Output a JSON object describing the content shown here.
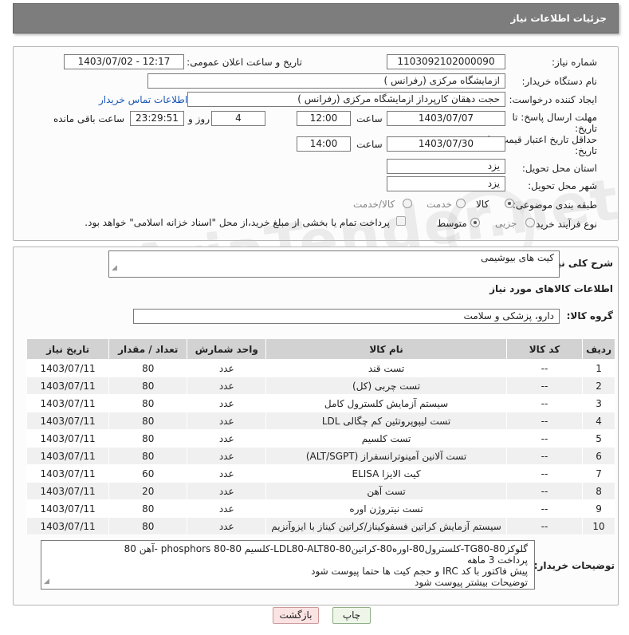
{
  "header": {
    "title": "جزئیات اطلاعات نیاز"
  },
  "form": {
    "need_number": {
      "label": "شماره نیاز:",
      "value": "1103092102000090"
    },
    "announce_datetime": {
      "label": "تاریخ و ساعت اعلان عمومی:",
      "value": "1403/07/02 - 12:17"
    },
    "buyer_org": {
      "label": "نام دستگاه خریدار:",
      "value": "ازمایشگاه مرکزی (رفرانس )"
    },
    "creator": {
      "label": "ایجاد کننده درخواست:",
      "value": "حجت دهقان کارپرداز ازمایشگاه مرکزی (رفرانس )",
      "contact_link": "اطلاعات تماس خریدار"
    },
    "reply_deadline": {
      "label_line1": "مهلت ارسال پاسخ: تا",
      "label_line2": "تاریخ:",
      "date": "1403/07/07",
      "time_label": "ساعت",
      "time": "12:00",
      "days": "4",
      "days_label": "روز و",
      "remaining": "23:29:51",
      "remaining_label": "ساعت باقی مانده"
    },
    "price_validity": {
      "label_line1": "حداقل تاریخ اعتبار قیمت: تا",
      "label_line2": "تاریخ:",
      "date": "1403/07/30",
      "time_label": "ساعت",
      "time": "14:00"
    },
    "delivery_province": {
      "label": "استان محل تحویل:",
      "value": "یزد"
    },
    "delivery_city": {
      "label": "شهر محل تحویل:",
      "value": "یزد"
    },
    "category": {
      "label": "طبقه بندی موضوعی:",
      "options": [
        "کالا",
        "خدمت",
        "کالا/خدمت"
      ],
      "selected": "کالا"
    },
    "purchase_type": {
      "label": "نوع فرآیند خرید :",
      "options": [
        "جزیی",
        "متوسط"
      ],
      "selected": "متوسط",
      "payment_note": "پرداخت تمام یا بخشی از مبلغ خرید،از محل \"اسناد خزانه اسلامی\" خواهد بود."
    }
  },
  "watermark": {
    "text": "AriaTender.net"
  },
  "summary": {
    "label": "شرح کلی نیاز:",
    "value": "کیت های بیوشیمی"
  },
  "goods_section": {
    "title": "اطلاعات کالاهای مورد نیاز"
  },
  "goods_group": {
    "label": "گروه کالا:",
    "value": "دارو، پزشکی و سلامت"
  },
  "table": {
    "headers": [
      "ردیف",
      "کد کالا",
      "نام کالا",
      "واحد شمارش",
      "تعداد / مقدار",
      "تاریخ نیاز"
    ],
    "rows": [
      [
        "1",
        "--",
        "تست قند",
        "عدد",
        "80",
        "1403/07/11"
      ],
      [
        "2",
        "--",
        "تست چربی (کل)",
        "عدد",
        "80",
        "1403/07/11"
      ],
      [
        "3",
        "--",
        "سیستم آزمایش کلسترول کامل",
        "عدد",
        "80",
        "1403/07/11"
      ],
      [
        "4",
        "--",
        "تست لیپوپروتئین کم چگالی LDL",
        "عدد",
        "80",
        "1403/07/11"
      ],
      [
        "5",
        "--",
        "تست کلسیم",
        "عدد",
        "80",
        "1403/07/11"
      ],
      [
        "6",
        "--",
        "تست آلانین آمینوترانسفراز (ALT/SGPT)",
        "عدد",
        "80",
        "1403/07/11"
      ],
      [
        "7",
        "--",
        "کیت الایزا ELISA",
        "عدد",
        "60",
        "1403/07/11"
      ],
      [
        "8",
        "--",
        "تست آهن",
        "عدد",
        "20",
        "1403/07/11"
      ],
      [
        "9",
        "--",
        "تست نیتروژن اوره",
        "عدد",
        "80",
        "1403/07/11"
      ],
      [
        "10",
        "--",
        "سیستم آزمایش کراتین فسفوکیناز/کراتین کیناز با ایزوآنزیم",
        "عدد",
        "80",
        "1403/07/11"
      ]
    ]
  },
  "buyer_notes": {
    "label": "توضیحات خریدار:",
    "lines": [
      "گلوکز80-TG80-کلسترول80-اوره80-کراتین80-LDL80-ALT80-کلسیم 80-phosphors 80 -آهن 80",
      "پرداخت 3 ماهه",
      "پیش فاکتور با کد IRC و حجم کیت ها حتما پیوست شود",
      "توضیحات بیشتر پیوست شود"
    ]
  },
  "buttons": {
    "print": "چاپ",
    "back": "بازگشت"
  }
}
